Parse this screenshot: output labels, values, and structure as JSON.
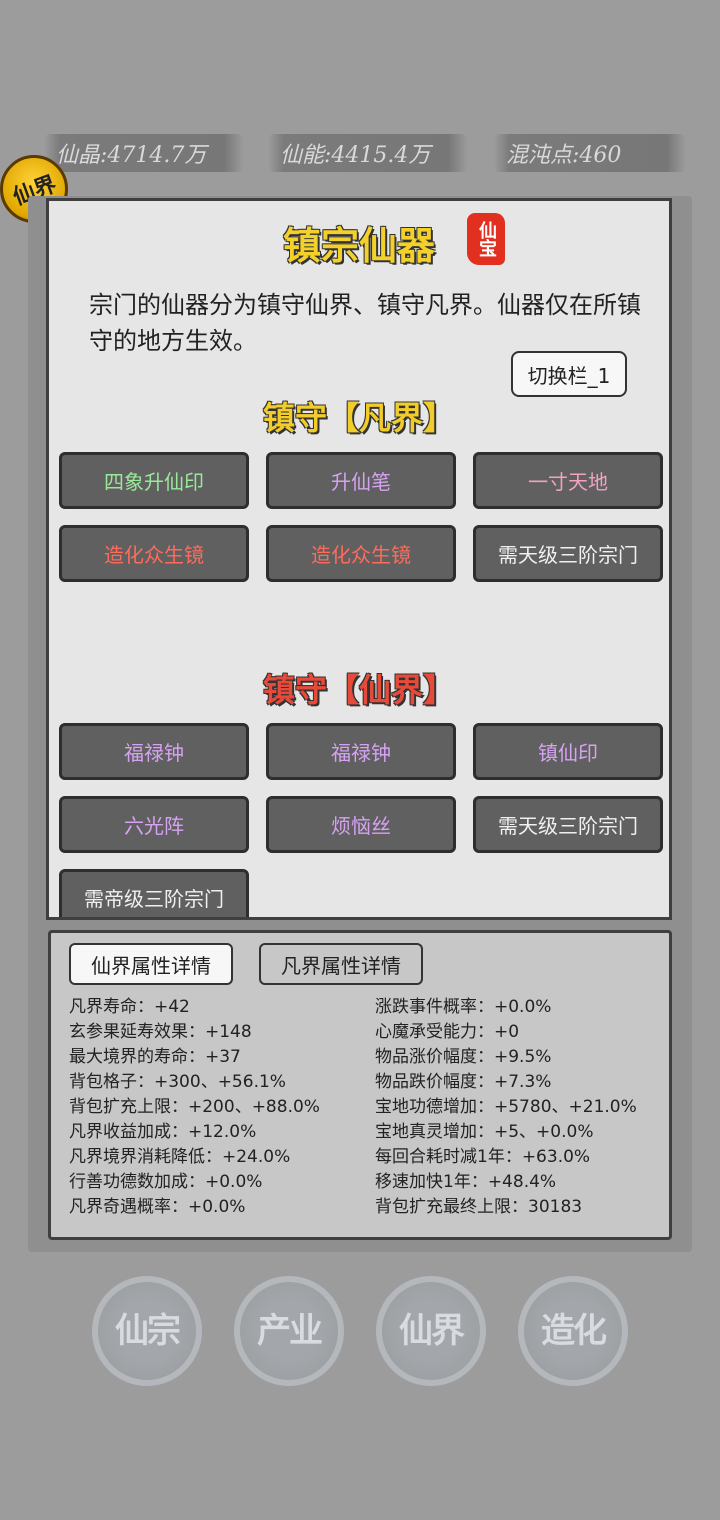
{
  "resources": {
    "crystal": "仙晶:4714.7万",
    "energy": "仙能:4415.4万",
    "chaos": "混沌点:460"
  },
  "avatar": {
    "label": "仙界"
  },
  "panel": {
    "title": "镇宗仙器",
    "seal": "仙宝",
    "description": "宗门的仙器分为镇守仙界、镇守凡界。仙器仅在所镇守的地方生效。",
    "switch_button": "切换栏_1"
  },
  "mortal_section": {
    "title": "镇守【凡界】",
    "slots": [
      {
        "label": "四象升仙印",
        "color": "green"
      },
      {
        "label": "升仙笔",
        "color": "purple"
      },
      {
        "label": "一寸天地",
        "color": "pink"
      },
      {
        "label": "造化众生镜",
        "color": "red"
      },
      {
        "label": "造化众生镜",
        "color": "red"
      },
      {
        "label": "需天级三阶宗门",
        "color": "white"
      }
    ]
  },
  "immortal_section": {
    "title": "镇守【仙界】",
    "slots": [
      {
        "label": "福禄钟",
        "color": "purple"
      },
      {
        "label": "福禄钟",
        "color": "purple"
      },
      {
        "label": "镇仙印",
        "color": "purple"
      },
      {
        "label": "六光阵",
        "color": "purple"
      },
      {
        "label": "烦恼丝",
        "color": "purple"
      },
      {
        "label": "需天级三阶宗门",
        "color": "white"
      },
      {
        "label": "需帝级三阶宗门",
        "color": "white"
      }
    ]
  },
  "attributes": {
    "tabs": [
      "仙界属性详情",
      "凡界属性详情"
    ],
    "left": [
      "凡界寿命：+42",
      "玄参果延寿效果：+148",
      "最大境界的寿命：+37",
      "背包格子：+300、+56.1%",
      "背包扩充上限：+200、+88.0%",
      "凡界收益加成：+12.0%",
      "凡界境界消耗降低：+24.0%",
      "行善功德数加成：+0.0%",
      "凡界奇遇概率：+0.0%"
    ],
    "right": [
      "涨跌事件概率：+0.0%",
      "心魔承受能力：+0",
      "物品涨价幅度：+9.5%",
      "物品跌价幅度：+7.3%",
      "宝地功德增加：+5780、+21.0%",
      "宝地真灵增加：+5、+0.0%",
      "每回合耗时减1年：+63.0%",
      "移速加快1年：+48.4%",
      "背包扩充最终上限：30183"
    ]
  },
  "nav": [
    "仙宗",
    "产业",
    "仙界",
    "造化"
  ]
}
